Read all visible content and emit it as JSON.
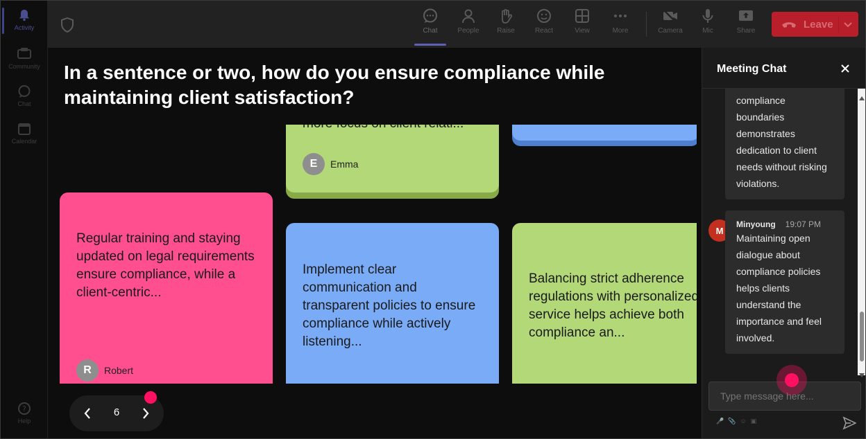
{
  "rail": [
    {
      "label": "Activity",
      "icon": "bell-icon",
      "active": true
    },
    {
      "label": "Community",
      "icon": "community-icon"
    },
    {
      "label": "Chat",
      "icon": "chat-icon"
    },
    {
      "label": "Calendar",
      "icon": "calendar-icon"
    },
    {
      "label": "Help",
      "icon": "help-icon"
    }
  ],
  "toolbar": {
    "buttons": [
      {
        "label": "Chat",
        "icon": "chat-icon",
        "active": true
      },
      {
        "label": "People",
        "icon": "people-icon"
      },
      {
        "label": "Raise",
        "icon": "raise-hand-icon"
      },
      {
        "label": "React",
        "icon": "smiley-icon"
      },
      {
        "label": "View",
        "icon": "grid-view-icon"
      },
      {
        "label": "More",
        "icon": "more-icon"
      },
      {
        "label": "Camera",
        "icon": "camera-off-icon"
      },
      {
        "label": "Mic",
        "icon": "mic-icon"
      },
      {
        "label": "Share",
        "icon": "share-icon"
      }
    ],
    "leave_label": "Leave"
  },
  "stage": {
    "question": "In a sentence or two, how do you ensure compliance while maintaining client satisfaction?",
    "cards": [
      {
        "id": "emma",
        "text": "more focus on client relati...",
        "author": "Emma",
        "initial": "E",
        "color": "#b3d878"
      },
      {
        "id": "blue-top",
        "text": "",
        "color": "#7aabf7"
      },
      {
        "id": "robert",
        "text": "Regular training and staying updated on legal requirements ensure compliance, while a client-centric...",
        "author": "Robert",
        "initial": "R",
        "color": "#ff4f8e"
      },
      {
        "id": "blue",
        "text": "Implement clear communication and transparent policies to ensure compliance while actively listening...",
        "color": "#7aabf7"
      },
      {
        "id": "green",
        "text": "Balancing strict adherence regulations with personalized service helps achieve both compliance an...",
        "color": "#b3d878"
      }
    ],
    "page": "6"
  },
  "chat": {
    "title": "Meeting Chat",
    "messages": [
      {
        "lines": [
          "compliance",
          "boundaries",
          "demonstrates",
          "dedication to client",
          "needs without risking",
          "violations."
        ]
      },
      {
        "author": "Minyoung",
        "time": "19:07 PM",
        "initial": "M",
        "lines": [
          "Maintaining open",
          "dialogue about",
          "compliance policies",
          "helps clients",
          "understand the",
          "importance and feel",
          "involved."
        ]
      }
    ],
    "input_placeholder": "Type message here..."
  }
}
